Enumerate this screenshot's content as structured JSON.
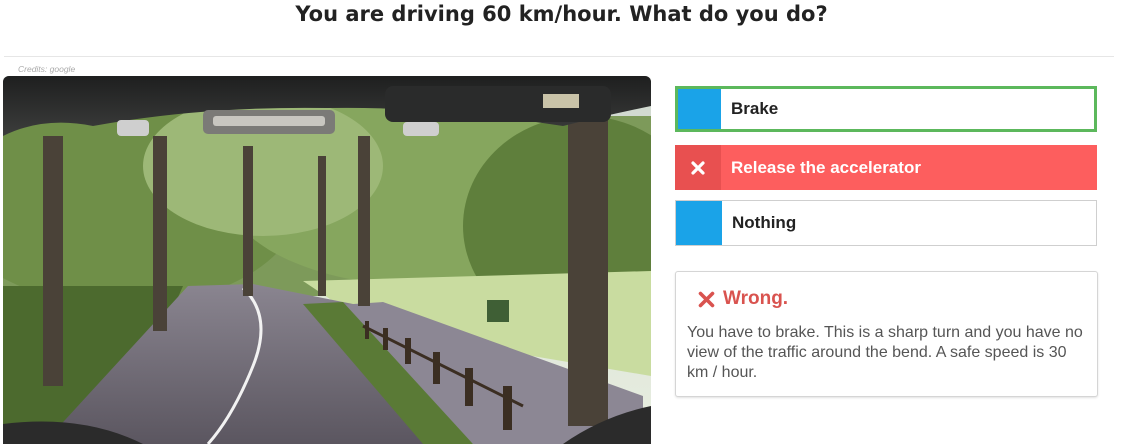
{
  "question": {
    "title": "You are driving 60 km/hour. What do you do?"
  },
  "image": {
    "credits": "Credits: google"
  },
  "options": [
    {
      "label": "Brake",
      "state": "correct"
    },
    {
      "label": "Release the accelerator",
      "state": "selected-wrong"
    },
    {
      "label": "Nothing",
      "state": "neutral"
    }
  ],
  "feedback": {
    "title": "Wrong.",
    "text": "You have to brake. This is a sharp turn and you have no view of the traffic around the bend. A safe speed is 30 km / hour."
  },
  "colors": {
    "marker_blue": "#1aa3e8",
    "correct_green": "#5cb85c",
    "wrong_red": "#fd5e5e",
    "wrong_text": "#d9534f"
  }
}
